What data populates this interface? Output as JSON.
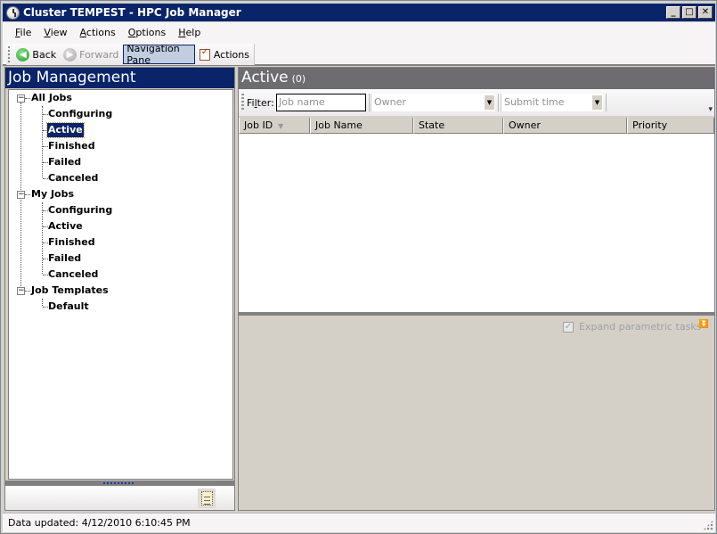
{
  "window": {
    "title": "Cluster TEMPEST - HPC Job Manager",
    "controls": {
      "minimize": "_",
      "maximize": "□",
      "close": "✕"
    }
  },
  "menubar": {
    "items": [
      {
        "label": "File",
        "access": "F"
      },
      {
        "label": "View",
        "access": "V"
      },
      {
        "label": "Actions",
        "access": "A"
      },
      {
        "label": "Options",
        "access": "O"
      },
      {
        "label": "Help",
        "access": "H"
      }
    ]
  },
  "toolbar": {
    "back_label": "Back",
    "forward_label": "Forward",
    "navigation_pane_label": "Navigation Pane",
    "actions_label": "Actions"
  },
  "nav": {
    "title": "Job Management",
    "groups": [
      {
        "label": "All Jobs",
        "children": [
          "Configuring",
          "Active",
          "Finished",
          "Failed",
          "Canceled"
        ]
      },
      {
        "label": "My Jobs",
        "children": [
          "Configuring",
          "Active",
          "Finished",
          "Failed",
          "Canceled"
        ]
      },
      {
        "label": "Job Templates",
        "children": [
          "Default"
        ]
      }
    ],
    "selected": "All Jobs > Active"
  },
  "main": {
    "title": "Active",
    "count": "(0)",
    "filter": {
      "label": "Filter:",
      "job_name_placeholder": "Job name",
      "owner_placeholder": "Owner",
      "submit_time_placeholder": "Submit time"
    },
    "columns": [
      "Job ID",
      "Job Name",
      "State",
      "Owner",
      "Priority"
    ],
    "rows": [],
    "detail": {
      "expand_parametric_label": "Expand parametric tasks",
      "expand_parametric_checked": true,
      "expand_parametric_enabled": false
    }
  },
  "status": {
    "text": "Data updated: 4/12/2010 6:10:45 PM"
  }
}
